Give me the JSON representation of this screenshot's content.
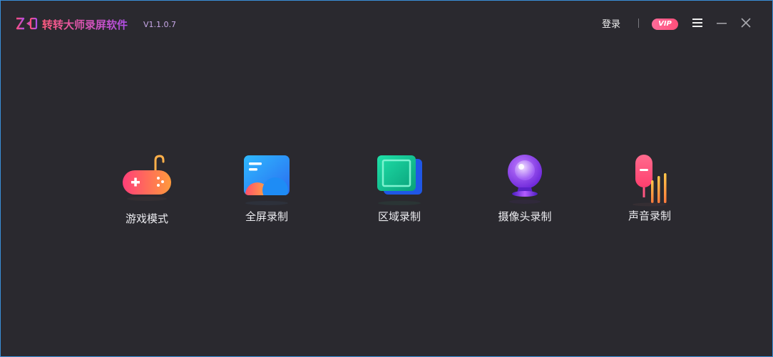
{
  "app": {
    "title": "转转大师录屏软件",
    "version": "V1.1.0.7"
  },
  "header": {
    "login_label": "登录",
    "vip_label": "VIP"
  },
  "modes": [
    {
      "label": "游戏模式",
      "icon": "gamepad-icon"
    },
    {
      "label": "全屏录制",
      "icon": "fullscreen-icon"
    },
    {
      "label": "区域录制",
      "icon": "region-icon"
    },
    {
      "label": "摄像头录制",
      "icon": "camera-icon"
    },
    {
      "label": "声音录制",
      "icon": "microphone-icon"
    }
  ],
  "colors": {
    "background": "#2a292f",
    "accent_pink": "#ff4f7a",
    "accent_purple": "#b04ee8",
    "window_border": "#3a8fd8"
  }
}
